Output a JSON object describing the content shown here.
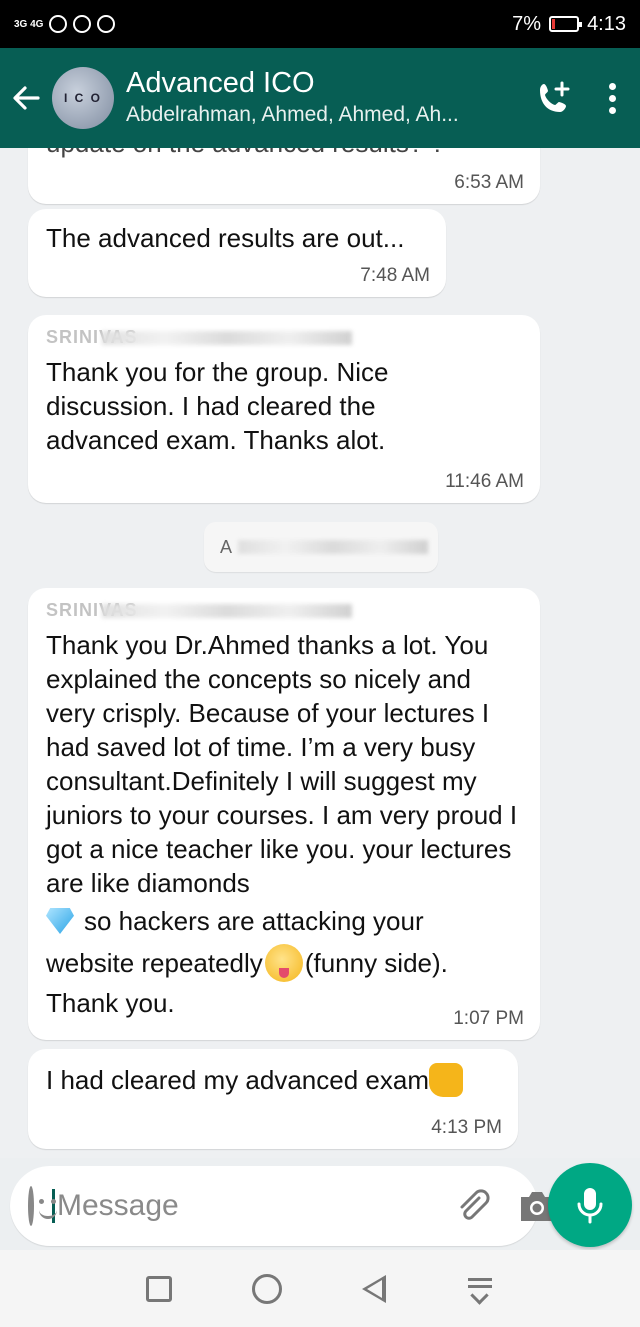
{
  "status_bar": {
    "network": "3G 4G",
    "battery": "7%",
    "time": "4:13"
  },
  "header": {
    "title": "Advanced ICO",
    "subtitle": "Abdelrahman, Ahmed, Ahmed, Ah...",
    "avatar_text": "I C O"
  },
  "messages": [
    {
      "id": "m0",
      "sender": "",
      "text": "update on the advanced results? ?",
      "time": "6:53 AM"
    },
    {
      "id": "m1",
      "sender": "",
      "text": "The advanced results are out...",
      "time": "7:48 AM"
    },
    {
      "id": "m2",
      "sender": "SRINIVAS",
      "text": "Thank you for the group. Nice discussion. I had cleared the advanced exam. Thanks alot.",
      "time": "11:46 AM"
    },
    {
      "id": "m3",
      "sender": "SRINIVAS",
      "text_before_diamond": "Thank you Dr.Ahmed thanks a lot. You explained the concepts so nicely and very crisply. Because of your lectures I had saved lot of time. I’m a very busy consultant.Definitely I will suggest my juniors to your courses. I am very proud I got a nice teacher like you. your lectures are like diamonds",
      "text_after_diamond": "so hackers are attacking your",
      "text_line_wink": "website repeatedly",
      "text_after_wink": "(funny side).",
      "text_end": "Thank you.",
      "time": "1:07 PM"
    },
    {
      "id": "m4",
      "sender": "",
      "text": "I had cleared my advanced exam",
      "time": "4:13 PM"
    }
  ],
  "system_pill": {
    "text": "A"
  },
  "input": {
    "placeholder": "Message"
  },
  "icons": {
    "back": "arrow-left-icon",
    "call": "add-call-icon",
    "menu": "more-vertical-icon",
    "emoji": "smiley-icon",
    "attach": "paperclip-icon",
    "camera": "camera-icon",
    "mic": "mic-icon"
  },
  "colors": {
    "header": "#075e54",
    "mic_button": "#00a884",
    "chat_bg": "#eef0f2"
  }
}
